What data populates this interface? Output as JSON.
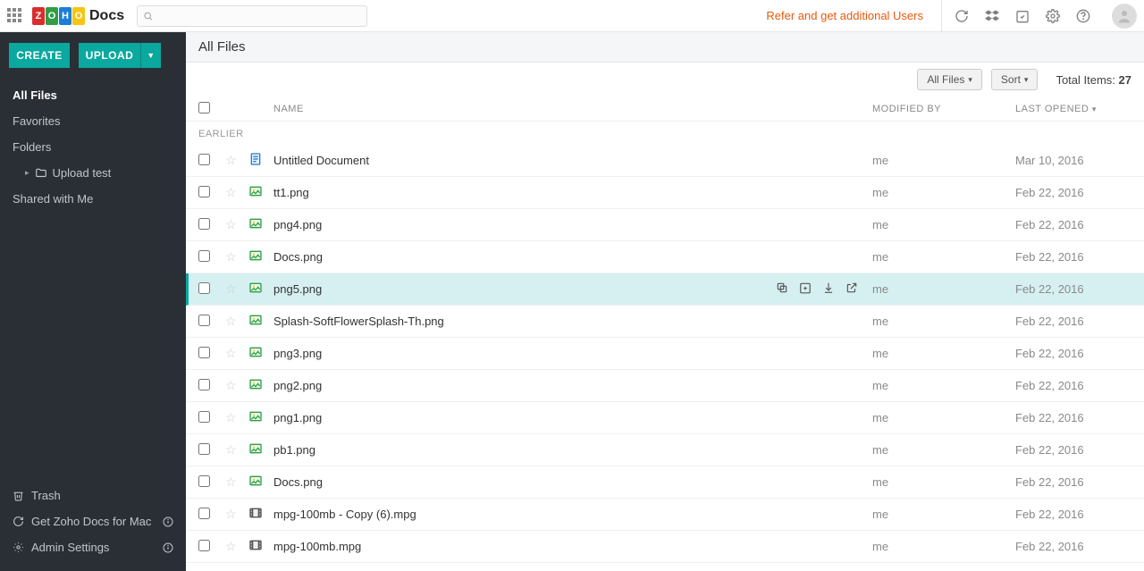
{
  "brand": {
    "docs_word": "Docs"
  },
  "topbar": {
    "search_placeholder": "",
    "refer_text": "Refer and get additional Users"
  },
  "sidebar": {
    "create_label": "CREATE",
    "upload_label": "UPLOAD",
    "items": {
      "all_files": "All Files",
      "favorites": "Favorites",
      "folders": "Folders",
      "upload_test": "Upload test",
      "shared": "Shared with Me"
    },
    "bottom": {
      "trash": "Trash",
      "get_mac": "Get Zoho Docs for Mac",
      "admin": "Admin Settings"
    }
  },
  "header": {
    "breadcrumb": "All Files",
    "filter_label": "All Files",
    "sort_label": "Sort",
    "total_prefix": "Total Items: ",
    "total_count": "27"
  },
  "columns": {
    "name": "NAME",
    "modified": "MODIFIED BY",
    "last": "LAST OPENED"
  },
  "group_label": "EARLIER",
  "files": [
    {
      "kind": "doc",
      "name": "Untitled Document",
      "modified": "me",
      "last": "Mar 10, 2016",
      "selected": false
    },
    {
      "kind": "image",
      "name": "tt1.png",
      "modified": "me",
      "last": "Feb 22, 2016",
      "selected": false
    },
    {
      "kind": "image",
      "name": "png4.png",
      "modified": "me",
      "last": "Feb 22, 2016",
      "selected": false
    },
    {
      "kind": "image",
      "name": "Docs.png",
      "modified": "me",
      "last": "Feb 22, 2016",
      "selected": false
    },
    {
      "kind": "image",
      "name": "png5.png",
      "modified": "me",
      "last": "Feb 22, 2016",
      "selected": true
    },
    {
      "kind": "image",
      "name": "Splash-SoftFlowerSplash-Th.png",
      "modified": "me",
      "last": "Feb 22, 2016",
      "selected": false
    },
    {
      "kind": "image",
      "name": "png3.png",
      "modified": "me",
      "last": "Feb 22, 2016",
      "selected": false
    },
    {
      "kind": "image",
      "name": "png2.png",
      "modified": "me",
      "last": "Feb 22, 2016",
      "selected": false
    },
    {
      "kind": "image",
      "name": "png1.png",
      "modified": "me",
      "last": "Feb 22, 2016",
      "selected": false
    },
    {
      "kind": "image",
      "name": "pb1.png",
      "modified": "me",
      "last": "Feb 22, 2016",
      "selected": false
    },
    {
      "kind": "image",
      "name": "Docs.png",
      "modified": "me",
      "last": "Feb 22, 2016",
      "selected": false
    },
    {
      "kind": "video",
      "name": "mpg-100mb - Copy (6).mpg",
      "modified": "me",
      "last": "Feb 22, 2016",
      "selected": false
    },
    {
      "kind": "video",
      "name": "mpg-100mb.mpg",
      "modified": "me",
      "last": "Feb 22, 2016",
      "selected": false
    }
  ]
}
